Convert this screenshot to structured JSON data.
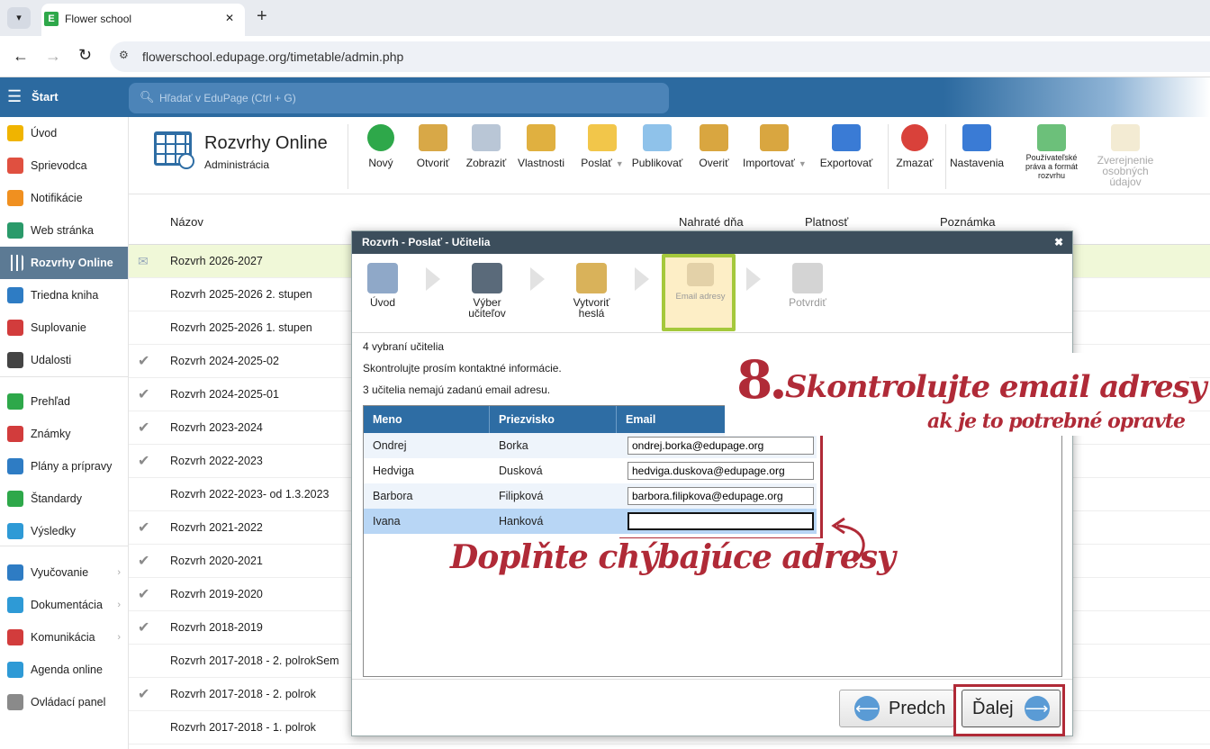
{
  "browser": {
    "tab_title": "Flower school",
    "url": "flowerschool.edupage.org/timetable/admin.php",
    "new_tab": "+",
    "close_tab": "✕"
  },
  "header": {
    "menu_label": "Štart",
    "search_placeholder": "Hľadať v EduPage (Ctrl + G)"
  },
  "sidebar": {
    "items": [
      {
        "label": "Úvod",
        "color": "#f0b400"
      },
      {
        "label": "Sprievodca",
        "color": "#e05040"
      },
      {
        "label": "Notifikácie",
        "color": "#f09020"
      },
      {
        "label": "Web stránka",
        "color": "#2a9a6a"
      },
      {
        "label": "Rozvrhy Online",
        "color": "#ffffff"
      },
      {
        "label": "Triedna kniha",
        "color": "#2e7cc4"
      },
      {
        "label": "Suplovanie",
        "color": "#d23c3c"
      },
      {
        "label": "Udalosti",
        "color": "#444444"
      },
      {
        "label": "Prehľad",
        "color": "#2ea84a"
      },
      {
        "label": "Známky",
        "color": "#d23c3c"
      },
      {
        "label": "Plány a prípravy",
        "color": "#2e7cc4"
      },
      {
        "label": "Štandardy",
        "color": "#2ea84a"
      },
      {
        "label": "Výsledky",
        "color": "#2e9ad6"
      },
      {
        "label": "Vyučovanie",
        "color": "#2e7cc4"
      },
      {
        "label": "Dokumentácia",
        "color": "#2e9ad6"
      },
      {
        "label": "Komunikácia",
        "color": "#d23c3c"
      },
      {
        "label": "Agenda online",
        "color": "#2e9ad6"
      },
      {
        "label": "Ovládací panel",
        "color": "#8a8a8a"
      }
    ]
  },
  "module": {
    "title": "Rozvrhy Online",
    "subtitle": "Administrácia"
  },
  "toolbar": {
    "items": [
      "Nový",
      "Otvoriť",
      "Zobraziť",
      "Vlastnosti",
      "Poslať",
      "Publikovať",
      "Overiť",
      "Importovať",
      "Exportovať",
      "Zmazať",
      "Nastavenia",
      "Používateľské práva a formát rozvrhu",
      "Zverejnenie osobných údajov"
    ],
    "dropdown_mark": "▼"
  },
  "table": {
    "headers": [
      "Názov",
      "Nahraté dňa",
      "Platnosť",
      "Poznámka"
    ],
    "rows": [
      "Rozvrh 2026-2027",
      "Rozvrh 2025-2026 2. stupen",
      "Rozvrh 2025-2026 1. stupen",
      "Rozvrh 2024-2025-02",
      "Rozvrh 2024-2025-01",
      "Rozvrh 2023-2024",
      "Rozvrh 2022-2023",
      "Rozvrh 2022-2023- od 1.3.2023",
      "Rozvrh 2021-2022",
      "Rozvrh 2020-2021",
      "Rozvrh 2019-2020",
      "Rozvrh 2018-2019",
      "Rozvrh 2017-2018 - 2. polrokSem",
      "Rozvrh 2017-2018 - 2. polrok",
      "Rozvrh 2017-2018 - 1. polrok"
    ],
    "check_mark": "✔"
  },
  "dialog": {
    "title": "Rozvrh - Poslať - Učitelia",
    "close": "✖",
    "steps": [
      "Úvod",
      "Výber učiteľov",
      "Vytvoriť heslá",
      "Email adresy",
      "Potvrdiť"
    ],
    "info1": "4 vybraní učitelia",
    "info2": "Skontrolujte prosím kontaktné informácie.",
    "info3": "3 učitelia nemajú zadanú email adresu.",
    "columns": [
      "Meno",
      "Priezvisko",
      "Email"
    ],
    "teachers": [
      {
        "first": "Ondrej",
        "last": "Borka",
        "email": "ondrej.borka@edupage.org"
      },
      {
        "first": "Hedviga",
        "last": "Dusková",
        "email": "hedviga.duskova@edupage.org"
      },
      {
        "first": "Barbora",
        "last": "Filipková",
        "email": "barbora.filipkova@edupage.org"
      },
      {
        "first": "Ivana",
        "last": "Hanková",
        "email": ""
      }
    ],
    "prev_label": "Predch",
    "next_label": "Ďalej",
    "prev_arrow": "⟵",
    "next_arrow": "⟶"
  },
  "annotations": {
    "step_number": "8.",
    "title": "Skontrolujte email adresy",
    "subtitle": "ak je to potrebné opravte",
    "fill": "Doplňte chýbajúce adresy",
    "accent": "#b02a37",
    "highlight": "#a5c83c"
  }
}
